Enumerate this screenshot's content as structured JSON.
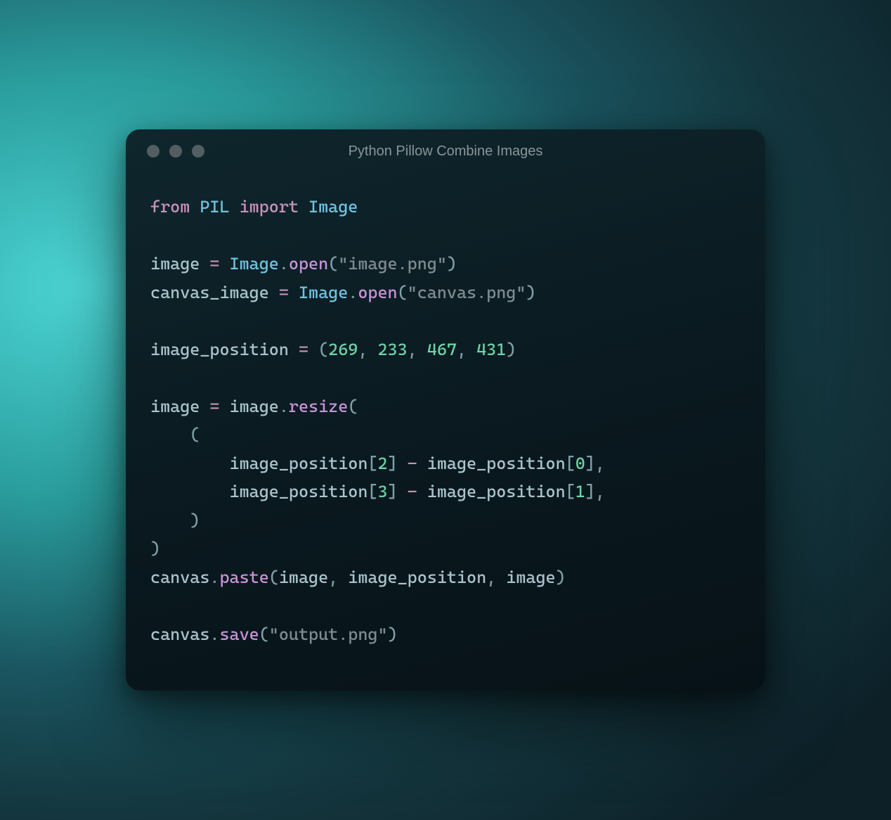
{
  "window": {
    "title": "Python Pillow Combine Images"
  },
  "code": {
    "kw_from": "from",
    "module": "PIL",
    "kw_import": "import",
    "cls_image": "Image",
    "var_image": "image",
    "var_canvas_image": "canvas_image",
    "var_canvas": "canvas",
    "var_image_position": "image_position",
    "fn_open": "open",
    "fn_resize": "resize",
    "fn_paste": "paste",
    "fn_save": "save",
    "str_image_png": "\"image.png\"",
    "str_canvas_png": "\"canvas.png\"",
    "str_output_png": "\"output.png\"",
    "num_269": "269",
    "num_233": "233",
    "num_467": "467",
    "num_431": "431",
    "num_0": "0",
    "num_1": "1",
    "num_2": "2",
    "num_3": "3",
    "eq": " = ",
    "dot": ".",
    "lp": "(",
    "rp": ")",
    "lb": "[",
    "rb": "]",
    "comma": ", ",
    "minus": " - ",
    "indent1": "    ",
    "indent2": "        "
  }
}
